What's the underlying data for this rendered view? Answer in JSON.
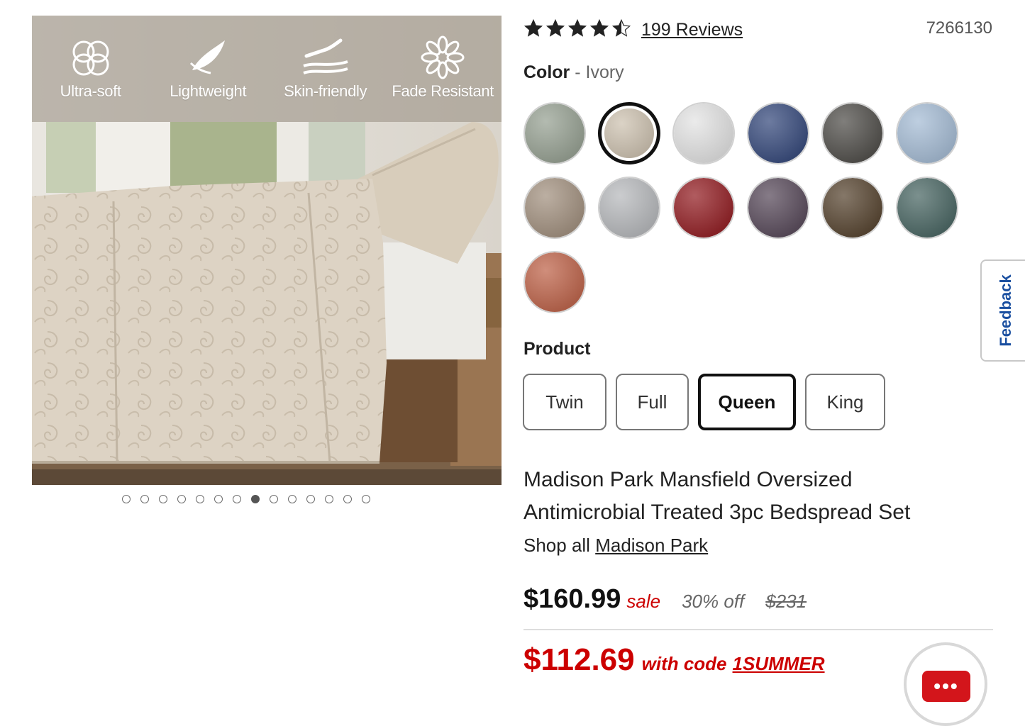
{
  "gallery": {
    "features": [
      {
        "label": "Ultra-soft",
        "icon": "cotton-icon"
      },
      {
        "label": "Lightweight",
        "icon": "feather-icon"
      },
      {
        "label": "Skin-friendly",
        "icon": "hand-wave-icon"
      },
      {
        "label": "Fade Resistant",
        "icon": "flower-icon"
      }
    ],
    "dot_count": 14,
    "active_dot": 8
  },
  "rating": {
    "stars": 4.5,
    "reviews_label": "199 Reviews"
  },
  "sku": "7266130",
  "color": {
    "label": "Color",
    "separator": " - ",
    "selected": "Ivory",
    "swatches": [
      {
        "color": "#9aa496"
      },
      {
        "color": "#cfc4b3",
        "selected": true
      },
      {
        "color": "#e4e4e4"
      },
      {
        "color": "#3c4f80"
      },
      {
        "color": "#55534f"
      },
      {
        "color": "#a8bed6"
      },
      {
        "color": "#a59483"
      },
      {
        "color": "#b9bbbe"
      },
      {
        "color": "#96252a"
      },
      {
        "color": "#5d4f5f"
      },
      {
        "color": "#5c4a36"
      },
      {
        "color": "#4f6b68"
      },
      {
        "color": "#c0684f"
      }
    ]
  },
  "product": {
    "label": "Product",
    "sizes": [
      {
        "label": "Twin"
      },
      {
        "label": "Full"
      },
      {
        "label": "Queen",
        "selected": true
      },
      {
        "label": "King"
      }
    ]
  },
  "title": "Madison Park Mansfield Oversized Antimicrobial Treated 3pc Bedspread Set",
  "shop_all": {
    "prefix": "Shop all",
    "brand": "Madison Park"
  },
  "price": {
    "current": "$160.99",
    "sale_label": "sale",
    "discount": "30% off",
    "original": "$231"
  },
  "promo": {
    "price": "$112.69",
    "with_code": "with code",
    "code": "1SUMMER"
  },
  "feedback_label": "Feedback",
  "chat_label": "•••",
  "colors": {
    "accent_red": "#cc0000",
    "feedback_blue": "#1a4fa0"
  }
}
